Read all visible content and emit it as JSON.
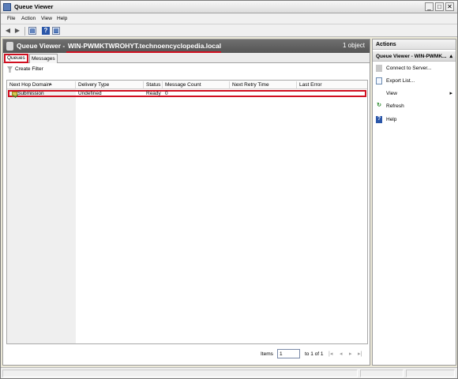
{
  "window": {
    "title": "Queue Viewer",
    "min": "_",
    "max": "□",
    "close": "✕"
  },
  "menu": {
    "items": [
      "File",
      "Action",
      "View",
      "Help"
    ]
  },
  "center": {
    "title": "Queue Viewer -",
    "server": "WIN-PWMKTWROHYT.technoencyclopedia.local",
    "count": "1 object",
    "tabs": [
      "Queues",
      "Messages"
    ],
    "create_filter": "Create Filter",
    "columns": [
      "Next Hop Domain",
      "Delivery Type",
      "Status",
      "Message Count",
      "Next Retry Time",
      "Last Error"
    ],
    "rows": [
      {
        "next_hop_domain": "Submission",
        "delivery_type": "Undefined",
        "status": "Ready",
        "message_count": "0",
        "next_retry_time": "",
        "last_error": ""
      }
    ],
    "pager": {
      "items_label": "Items",
      "page_value": "1",
      "of_label": "to 1 of 1"
    }
  },
  "actions": {
    "header": "Actions",
    "section": "Queue Viewer - WIN-PWMK...",
    "items": [
      {
        "label": "Connect to Server...",
        "icon": "server-icon"
      },
      {
        "label": "Export List...",
        "icon": "export-icon"
      },
      {
        "label": "View",
        "icon": "none"
      },
      {
        "label": "Refresh",
        "icon": "refresh-icon"
      },
      {
        "label": "Help",
        "icon": "help-icon"
      }
    ]
  }
}
